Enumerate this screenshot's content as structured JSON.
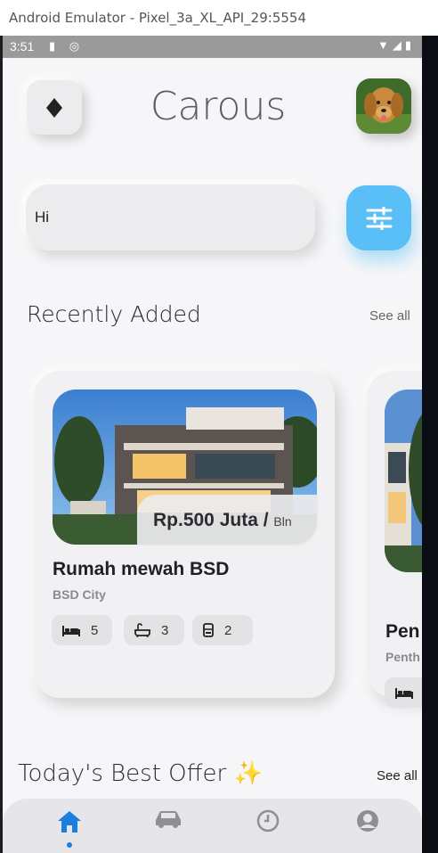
{
  "window": {
    "title": "Android Emulator - Pixel_3a_XL_API_29:5554"
  },
  "status_bar": {
    "time": "3:51"
  },
  "header": {
    "title": "Carous",
    "menu_icon": "diamond-icon",
    "avatar_icon": "dog-avatar"
  },
  "search": {
    "value": "Hi",
    "placeholder": ""
  },
  "recent": {
    "title": "Recently Added",
    "see_all": "See all",
    "cards": [
      {
        "name": "Rumah mewah BSD",
        "location": "BSD City",
        "price": "Rp.500 Juta / ",
        "price_unit": "Bln",
        "beds": "5",
        "baths": "3",
        "parking": "2"
      },
      {
        "name": "Pen",
        "location": "Penth"
      }
    ]
  },
  "best_offer": {
    "title": "Today's Best Offer ✨",
    "see_all": "See all"
  },
  "nav": {
    "items": [
      "home-icon",
      "car-icon",
      "history-icon",
      "profile-icon"
    ],
    "active_index": 0,
    "active_color": "#1b7fe0",
    "inactive_color": "#8e8e93"
  },
  "colors": {
    "accent": "#59bff6",
    "background": "#f6f6f8"
  }
}
